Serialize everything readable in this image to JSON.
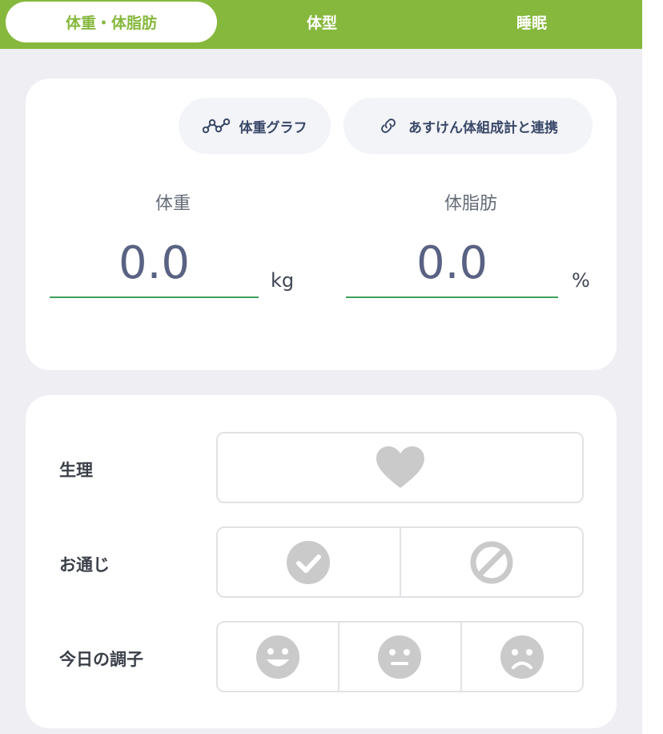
{
  "tabs": [
    {
      "label": "体重・体脂肪",
      "active": true
    },
    {
      "label": "体型",
      "active": false
    },
    {
      "label": "睡眠",
      "active": false
    }
  ],
  "weight_card": {
    "graph_button": "体重グラフ",
    "link_button": "あすけん体組成計と連携",
    "weight": {
      "label": "体重",
      "value": "0.0",
      "unit": "kg"
    },
    "body_fat": {
      "label": "体脂肪",
      "value": "0.0",
      "unit": "%"
    }
  },
  "condition_card": {
    "period": {
      "label": "生理",
      "icon": "heart-icon"
    },
    "bowel": {
      "label": "お通じ",
      "icons": [
        "check-circle-icon",
        "prohibited-icon"
      ]
    },
    "mood": {
      "label": "今日の調子",
      "icons": [
        "smile-face-icon",
        "neutral-face-icon",
        "sad-face-icon"
      ]
    }
  },
  "colors": {
    "brand_green": "#86b83d",
    "input_underline": "#3ea05a",
    "icon_gray": "#cacaca",
    "background": "#eeeef3"
  }
}
